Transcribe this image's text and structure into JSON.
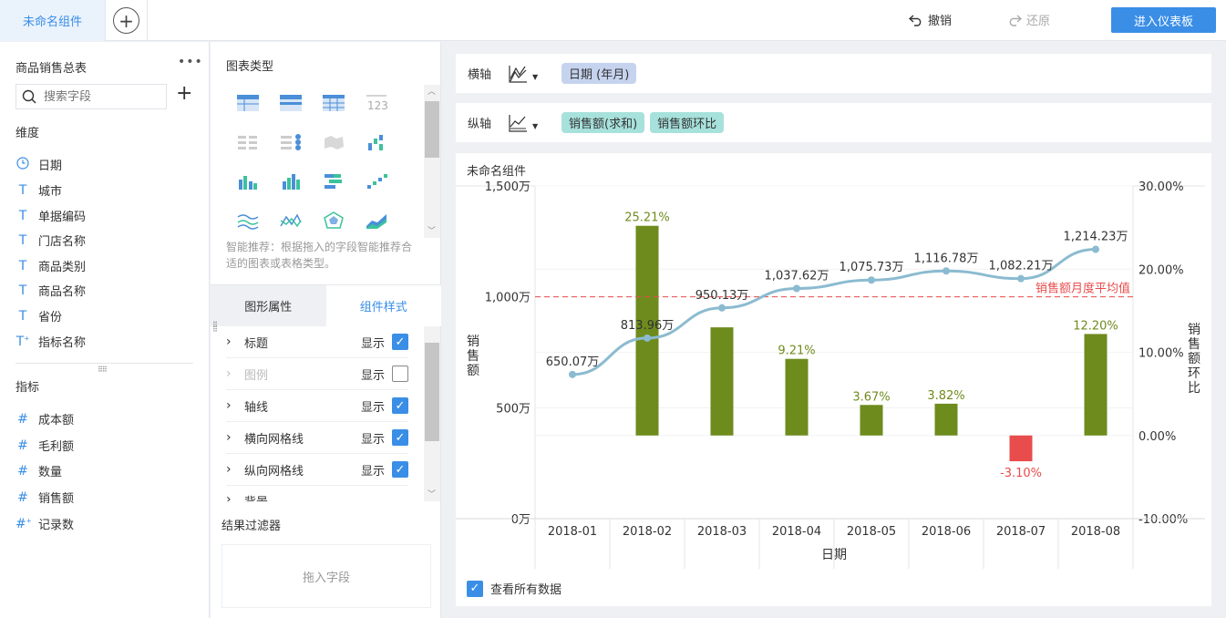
{
  "header": {
    "tab_title": "未命名组件",
    "undo_label": "撤销",
    "redo_label": "还原",
    "enter_dashboard_label": "进入仪表板"
  },
  "data_panel": {
    "title": "商品销售总表",
    "search_placeholder": "搜索字段",
    "dimensions_label": "维度",
    "dimensions": [
      {
        "name": "日期",
        "icon": "clock-icon"
      },
      {
        "name": "城市",
        "icon": "text-icon"
      },
      {
        "name": "单据编码",
        "icon": "text-icon"
      },
      {
        "name": "门店名称",
        "icon": "text-icon"
      },
      {
        "name": "商品类别",
        "icon": "text-icon"
      },
      {
        "name": "商品名称",
        "icon": "text-icon"
      },
      {
        "name": "省份",
        "icon": "text-icon"
      },
      {
        "name": "指标名称",
        "icon": "text-formula-icon"
      }
    ],
    "measures_label": "指标",
    "measures": [
      {
        "name": "成本额",
        "icon": "hash-icon"
      },
      {
        "name": "毛利额",
        "icon": "hash-icon"
      },
      {
        "name": "数量",
        "icon": "hash-icon"
      },
      {
        "name": "销售额",
        "icon": "hash-icon"
      },
      {
        "name": "记录数",
        "icon": "hash-formula-icon"
      }
    ]
  },
  "chart_types_panel": {
    "title": "图表类型",
    "hint": "智能推荐：根据拖入的字段智能推荐合适的图表或表格类型。",
    "tabs": [
      "图形属性",
      "组件样式"
    ],
    "properties": [
      {
        "name": "标题",
        "show_label": "显示",
        "checked": true,
        "disabled": false
      },
      {
        "name": "图例",
        "show_label": "显示",
        "checked": false,
        "disabled": true
      },
      {
        "name": "轴线",
        "show_label": "显示",
        "checked": true,
        "disabled": false
      },
      {
        "name": "横向网格线",
        "show_label": "显示",
        "checked": true,
        "disabled": false
      },
      {
        "name": "纵向网格线",
        "show_label": "显示",
        "checked": true,
        "disabled": false
      },
      {
        "name": "背景",
        "show_label": "",
        "checked": false,
        "disabled": false
      }
    ],
    "filter_title": "结果过滤器",
    "drop_placeholder": "拖入字段"
  },
  "axes_config": {
    "x_label": "横轴",
    "x_fields": [
      "日期 (年月)"
    ],
    "y_label": "纵轴",
    "y_fields": [
      "销售额(求和)",
      "销售额环比"
    ]
  },
  "chart_card": {
    "title": "未命名组件",
    "view_all_label": "查看所有数据",
    "view_all_checked": true
  },
  "chart_data": {
    "type": "bar",
    "xlabel": "日期",
    "ylabel": "销售额",
    "y2label": "销售额环比",
    "categories": [
      "2018-01",
      "2018-02",
      "2018-03",
      "2018-04",
      "2018-05",
      "2018-06",
      "2018-07",
      "2018-08"
    ],
    "series": [
      {
        "name": "销售额",
        "type": "line",
        "axis": "left",
        "color": "#8bbbd0",
        "values": [
          650.07,
          813.96,
          950.13,
          1037.62,
          1075.73,
          1116.78,
          1082.21,
          1214.23
        ],
        "labels": [
          "650.07万",
          "813.96万",
          "950.13万",
          "1,037.62万",
          "1,075.73万",
          "1,116.78万",
          "1,082.21万",
          "1,214.23万"
        ]
      },
      {
        "name": "销售额环比",
        "type": "bar",
        "axis": "right",
        "color": "#6e8b1d",
        "negative_color": "#e84c4c",
        "values": [
          null,
          25.21,
          13.0,
          9.21,
          3.67,
          3.82,
          -3.1,
          12.2
        ],
        "labels": [
          "",
          "25.21%",
          "",
          "9.21%",
          "3.67%",
          "3.82%",
          "-3.10%",
          "12.20%"
        ]
      }
    ],
    "ylim": [
      0,
      1500
    ],
    "yticks": [
      "0万",
      "500万",
      "1,000万",
      "1,500万"
    ],
    "y2lim": [
      -10,
      30
    ],
    "y2ticks": [
      "-10.00%",
      "0.00%",
      "10.00%",
      "20.00%",
      "30.00%"
    ],
    "reference_line": {
      "value": 1000,
      "label": "销售额月度平均值",
      "color": "#e84c4c"
    },
    "grid": true
  }
}
